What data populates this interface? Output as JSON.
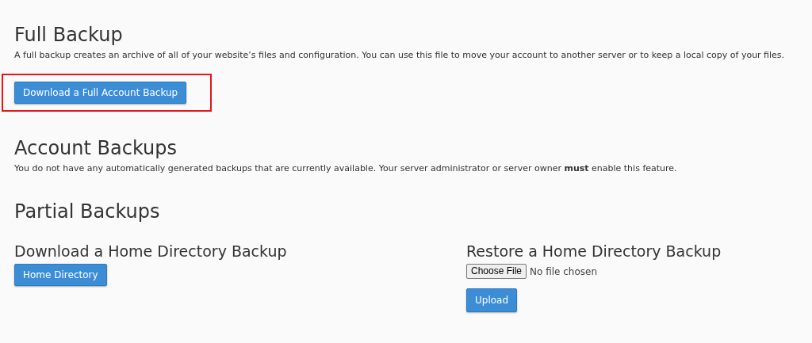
{
  "full_backup": {
    "title": "Full Backup",
    "description": "A full backup creates an archive of all of your website’s files and configuration. You can use this file to move your account to another server or to keep a local copy of your files.",
    "button": {
      "label": "Download a Full Account Backup",
      "highlighted": true
    }
  },
  "account_backups": {
    "title": "Account Backups",
    "description": "You do not have any automatically generated backups that are currently available. Your server administrator or server owner **must** enable this feature."
  },
  "partial_backups": {
    "title": "Partial Backups",
    "download": {
      "title": "Download a Home Directory Backup",
      "button": "Home Directory"
    },
    "restore": {
      "title": "Restore a Home Directory Backup",
      "file_button": "Choose File",
      "file_status": "No file chosen",
      "button": "Upload"
    }
  }
}
